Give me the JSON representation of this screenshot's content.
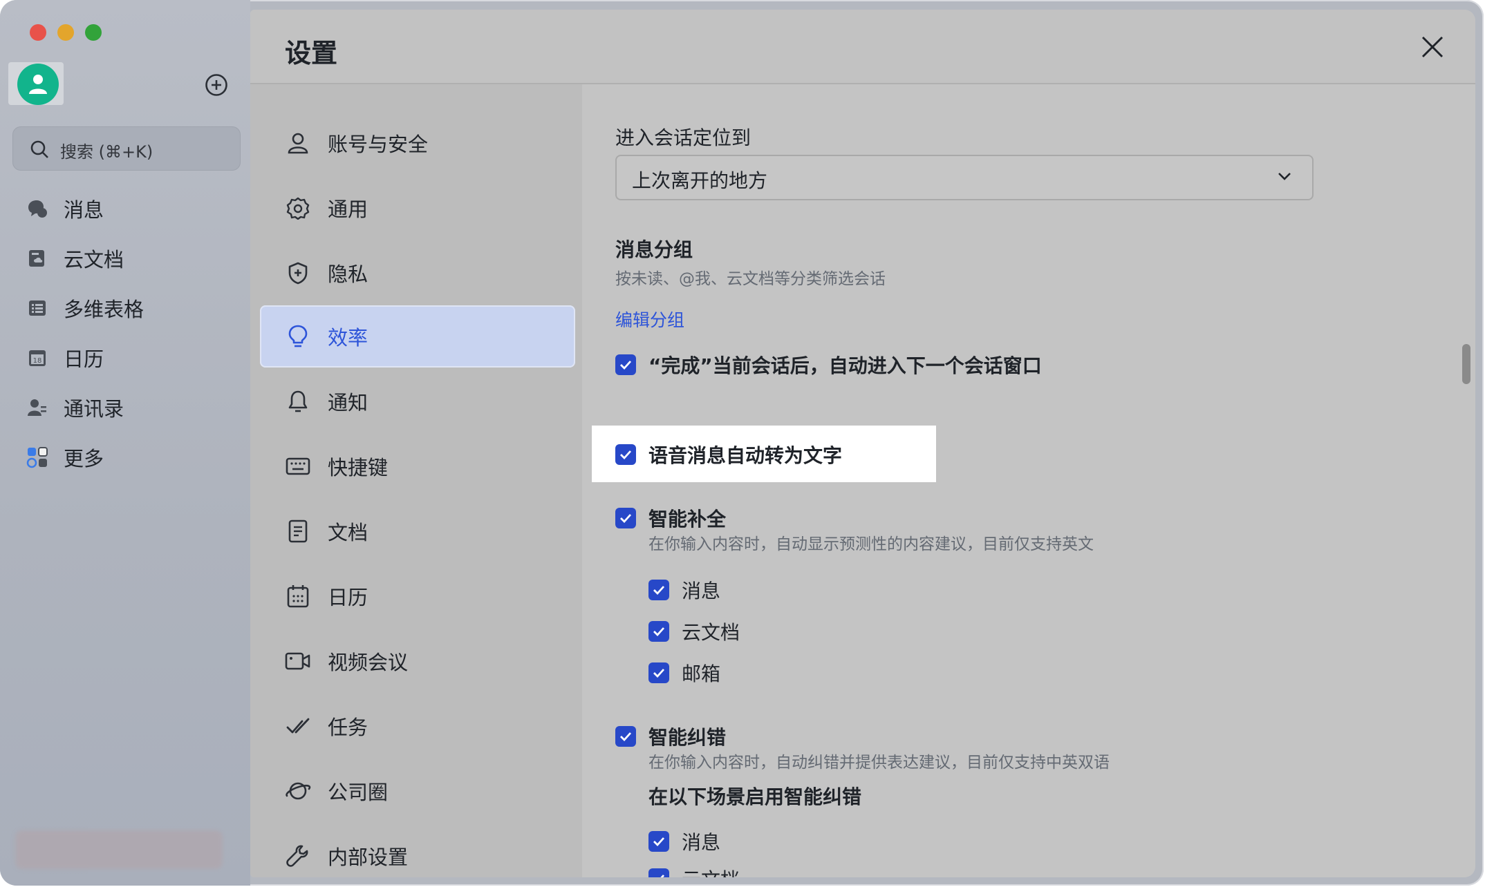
{
  "sidebar": {
    "search_placeholder": "搜索 (⌘+K)",
    "items": [
      {
        "label": "消息",
        "icon": "chat-bubble-icon"
      },
      {
        "label": "云文档",
        "icon": "cloud-doc-icon"
      },
      {
        "label": "多维表格",
        "icon": "base-table-icon"
      },
      {
        "label": "日历",
        "icon": "calendar-icon"
      },
      {
        "label": "通讯录",
        "icon": "contacts-icon"
      },
      {
        "label": "更多",
        "icon": "more-apps-icon"
      }
    ]
  },
  "dialog": {
    "title": "设置",
    "menu": [
      {
        "label": "账号与安全",
        "icon": "person-icon"
      },
      {
        "label": "通用",
        "icon": "gear-icon"
      },
      {
        "label": "隐私",
        "icon": "shield-icon"
      },
      {
        "label": "效率",
        "icon": "lightbulb-icon",
        "active": true
      },
      {
        "label": "通知",
        "icon": "bell-icon"
      },
      {
        "label": "快捷键",
        "icon": "keyboard-icon"
      },
      {
        "label": "文档",
        "icon": "document-icon"
      },
      {
        "label": "日历",
        "icon": "calendar-icon"
      },
      {
        "label": "视频会议",
        "icon": "video-camera-icon"
      },
      {
        "label": "任务",
        "icon": "task-check-icon"
      },
      {
        "label": "公司圈",
        "icon": "planet-icon"
      },
      {
        "label": "内部设置",
        "icon": "wrench-icon"
      }
    ],
    "content": {
      "enter_chat_label": "进入会话定位到",
      "enter_chat_value": "上次离开的地方",
      "grouping_title": "消息分组",
      "grouping_desc": "按未读、@我、云文档等分类筛选会话",
      "edit_group_link": "编辑分组",
      "done_next_label": "“完成”当前会话后，自动进入下一个会话窗口",
      "voice_to_text_label": "语音消息自动转为文字",
      "autocomplete_title": "智能补全",
      "autocomplete_desc": "在你输入内容时，自动显示预测性的内容建议，目前仅支持英文",
      "autocomplete_opts": [
        "消息",
        "云文档",
        "邮箱"
      ],
      "spellcheck_title": "智能纠错",
      "spellcheck_desc": "在你输入内容时，自动纠错并提供表达建议，目前仅支持中英双语",
      "spellcheck_scene_title": "在以下场景启用智能纠错",
      "spellcheck_opts": [
        "消息",
        "云文档"
      ]
    }
  },
  "colors": {
    "accent": "#2d54d9",
    "checkbox": "#2748c8",
    "avatar": "#12b48c"
  }
}
